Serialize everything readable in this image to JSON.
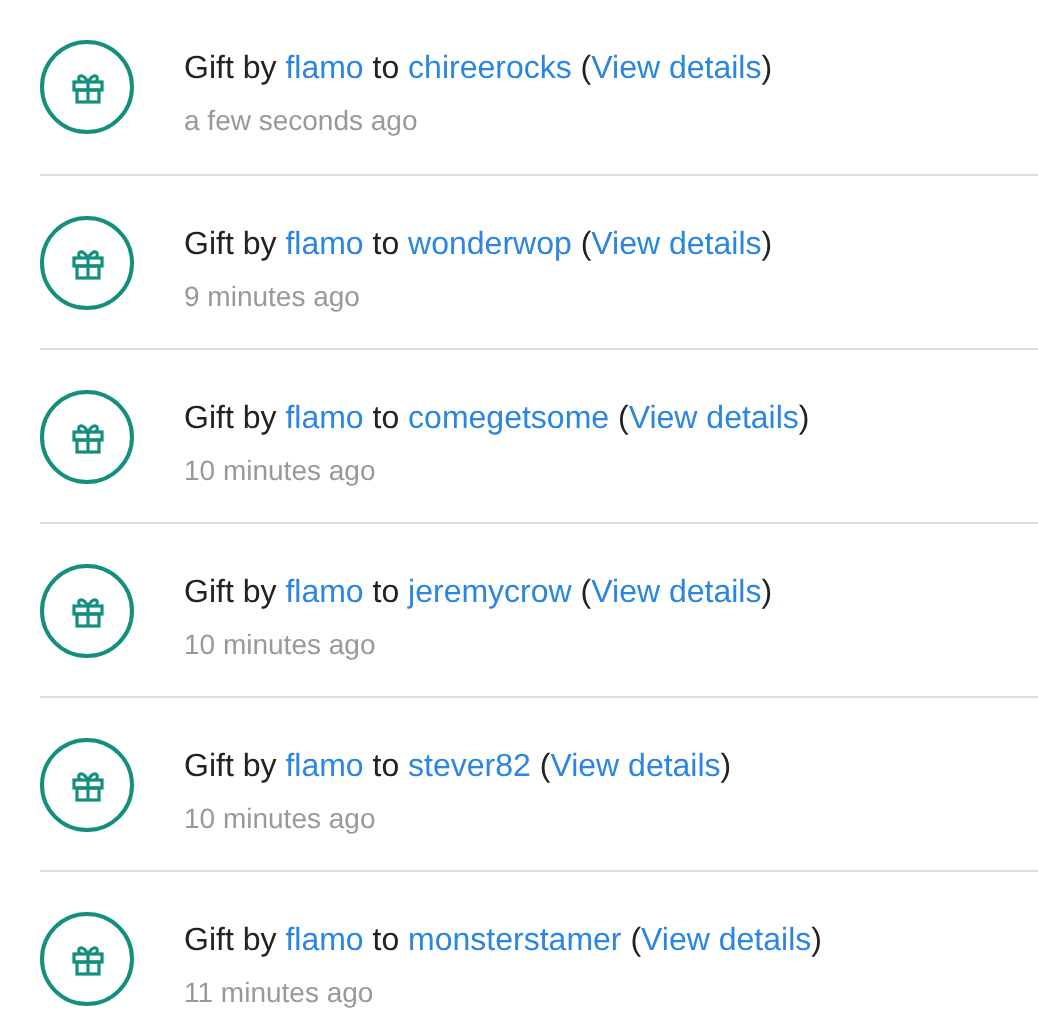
{
  "gifts": [
    {
      "prefix": "Gift by",
      "giver": "flamo",
      "joiner": "to",
      "recipient": "chireerocks",
      "open": "(",
      "link": "View details",
      "close": ")",
      "time": "a few seconds ago"
    },
    {
      "prefix": "Gift by",
      "giver": "flamo",
      "joiner": "to",
      "recipient": "wonderwop",
      "open": "(",
      "link": "View details",
      "close": ")",
      "time": "9 minutes ago"
    },
    {
      "prefix": "Gift by",
      "giver": "flamo",
      "joiner": "to",
      "recipient": "comegetsome",
      "open": "(",
      "link": "View details",
      "close": ")",
      "time": "10 minutes ago"
    },
    {
      "prefix": "Gift by",
      "giver": "flamo",
      "joiner": "to",
      "recipient": "jeremycrow",
      "open": "(",
      "link": "View details",
      "close": ")",
      "time": "10 minutes ago"
    },
    {
      "prefix": "Gift by",
      "giver": "flamo",
      "joiner": "to",
      "recipient": "stever82",
      "open": "(",
      "link": "View details",
      "close": ")",
      "time": "10 minutes ago"
    },
    {
      "prefix": "Gift by",
      "giver": "flamo",
      "joiner": "to",
      "recipient": "monsterstamer",
      "open": "(",
      "link": "View details",
      "close": ")",
      "time": "11 minutes ago"
    }
  ]
}
